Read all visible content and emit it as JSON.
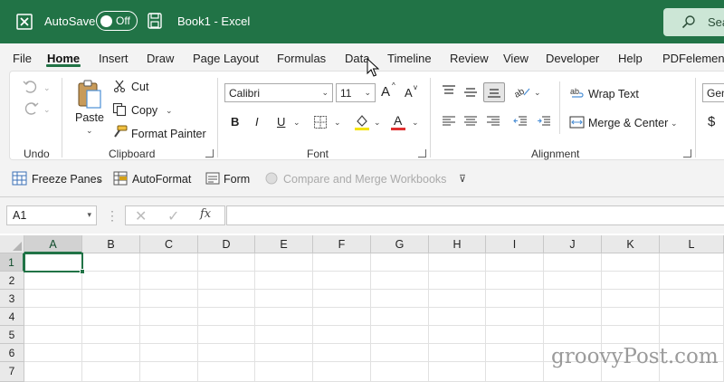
{
  "titlebar": {
    "autosave_label": "AutoSave",
    "autosave_state": "Off",
    "title": "Book1  -  Excel",
    "search_placeholder": "Sea"
  },
  "menu": {
    "tabs": [
      "File",
      "Home",
      "Insert",
      "Draw",
      "Page Layout",
      "Formulas",
      "Data",
      "Timeline",
      "Review",
      "View",
      "Developer",
      "Help",
      "PDFelement"
    ],
    "active": "Home"
  },
  "ribbon": {
    "undo_group": "Undo",
    "clipboard": {
      "group": "Clipboard",
      "paste": "Paste",
      "cut": "Cut",
      "copy": "Copy",
      "format_painter": "Format Painter"
    },
    "font": {
      "group": "Font",
      "font_name": "Calibri",
      "font_size": "11",
      "bold": "B",
      "italic": "I",
      "underline": "U",
      "grow": "A",
      "shrink": "A",
      "font_color_letter": "A"
    },
    "alignment": {
      "group": "Alignment",
      "wrap_text": "Wrap Text",
      "merge_center": "Merge & Center"
    },
    "number": {
      "format_partial": "Gen",
      "currency": "$"
    }
  },
  "quickbar": {
    "freeze_panes": "Freeze Panes",
    "autoformat": "AutoFormat",
    "form": "Form",
    "compare_merge": "Compare and Merge Workbooks"
  },
  "formula_bar": {
    "name_box": "A1",
    "fx": "fx",
    "value": ""
  },
  "grid": {
    "columns": [
      "A",
      "B",
      "C",
      "D",
      "E",
      "F",
      "G",
      "H",
      "I",
      "J",
      "K",
      "L"
    ],
    "rows": [
      "1",
      "2",
      "3",
      "4",
      "5",
      "6",
      "7"
    ],
    "active_cell": "A1"
  },
  "watermark": "groovyPost.com",
  "colors": {
    "brand": "#217346",
    "font_color_bar": "#e03030",
    "highlight_bar": "#f5e400"
  }
}
